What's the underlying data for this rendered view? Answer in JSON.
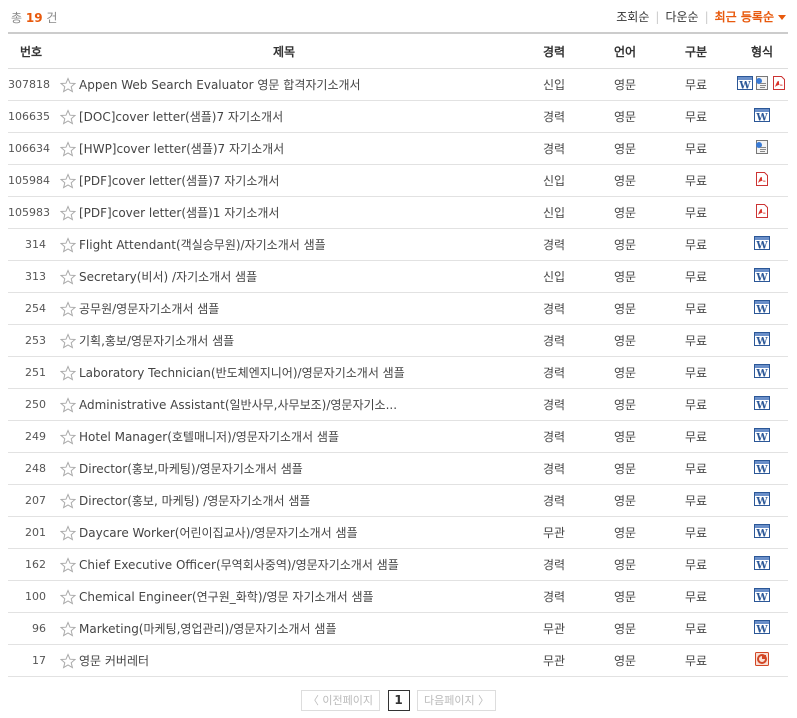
{
  "summary": {
    "prefix": "총",
    "count": "19",
    "suffix": "건"
  },
  "sort": {
    "views": "조회순",
    "downloads": "다운순",
    "recent": "최근 등록순"
  },
  "columns": {
    "no": "번호",
    "title": "제목",
    "career": "경력",
    "lang": "언어",
    "type": "구분",
    "format": "형식"
  },
  "rows": [
    {
      "no": "307818",
      "title": "Appen Web Search Evaluator 영문 합격자기소개서",
      "career": "신입",
      "lang": "영문",
      "type": "무료",
      "formats": [
        "doc",
        "hwp",
        "pdf"
      ]
    },
    {
      "no": "106635",
      "title": "[DOC]cover letter(샘플)7 자기소개서",
      "career": "경력",
      "lang": "영문",
      "type": "무료",
      "formats": [
        "doc"
      ]
    },
    {
      "no": "106634",
      "title": "[HWP]cover letter(샘플)7 자기소개서",
      "career": "경력",
      "lang": "영문",
      "type": "무료",
      "formats": [
        "hwp"
      ]
    },
    {
      "no": "105984",
      "title": "[PDF]cover letter(샘플)7 자기소개서",
      "career": "신입",
      "lang": "영문",
      "type": "무료",
      "formats": [
        "pdf"
      ]
    },
    {
      "no": "105983",
      "title": "[PDF]cover letter(샘플)1 자기소개서",
      "career": "신입",
      "lang": "영문",
      "type": "무료",
      "formats": [
        "pdf"
      ]
    },
    {
      "no": "314",
      "title": "Flight Attendant(객실승무원)/자기소개서 샘플",
      "career": "경력",
      "lang": "영문",
      "type": "무료",
      "formats": [
        "doc"
      ]
    },
    {
      "no": "313",
      "title": "Secretary(비서) /자기소개서 샘플",
      "career": "신입",
      "lang": "영문",
      "type": "무료",
      "formats": [
        "doc"
      ]
    },
    {
      "no": "254",
      "title": "공무원/영문자기소개서 샘플",
      "career": "경력",
      "lang": "영문",
      "type": "무료",
      "formats": [
        "doc"
      ]
    },
    {
      "no": "253",
      "title": "기획,홍보/영문자기소개서 샘플",
      "career": "경력",
      "lang": "영문",
      "type": "무료",
      "formats": [
        "doc"
      ]
    },
    {
      "no": "251",
      "title": "Laboratory Technician(반도체엔지니어)/영문자기소개서 샘플",
      "career": "경력",
      "lang": "영문",
      "type": "무료",
      "formats": [
        "doc"
      ]
    },
    {
      "no": "250",
      "title": "Administrative Assistant(일반사무,사무보조)/영문자기소...",
      "career": "경력",
      "lang": "영문",
      "type": "무료",
      "formats": [
        "doc"
      ]
    },
    {
      "no": "249",
      "title": "Hotel Manager(호텔매니저)/영문자기소개서 샘플",
      "career": "경력",
      "lang": "영문",
      "type": "무료",
      "formats": [
        "doc"
      ]
    },
    {
      "no": "248",
      "title": "Director(홍보,마케팅)/영문자기소개서 샘플",
      "career": "경력",
      "lang": "영문",
      "type": "무료",
      "formats": [
        "doc"
      ]
    },
    {
      "no": "207",
      "title": "Director(홍보, 마케팅) /영문자기소개서 샘플",
      "career": "경력",
      "lang": "영문",
      "type": "무료",
      "formats": [
        "doc"
      ]
    },
    {
      "no": "201",
      "title": "Daycare Worker(어린이집교사)/영문자기소개서 샘플",
      "career": "무관",
      "lang": "영문",
      "type": "무료",
      "formats": [
        "doc"
      ]
    },
    {
      "no": "162",
      "title": "Chief Executive Officer(무역회사중역)/영문자기소개서 샘플",
      "career": "경력",
      "lang": "영문",
      "type": "무료",
      "formats": [
        "doc"
      ]
    },
    {
      "no": "100",
      "title": "Chemical Engineer(연구원_화학)/영문 자기소개서 샘플",
      "career": "경력",
      "lang": "영문",
      "type": "무료",
      "formats": [
        "doc"
      ]
    },
    {
      "no": "96",
      "title": "Marketing(마케팅,영업관리)/영문자기소개서 샘플",
      "career": "무관",
      "lang": "영문",
      "type": "무료",
      "formats": [
        "doc"
      ]
    },
    {
      "no": "17",
      "title": "영문 커버레터",
      "career": "무관",
      "lang": "영문",
      "type": "무료",
      "formats": [
        "ppt"
      ]
    }
  ],
  "pagination": {
    "prev": "〈 이전페이지",
    "current": "1",
    "next": "다음페이지 〉"
  },
  "colors": {
    "accent": "#e8590c",
    "doc": "#2b5797",
    "pdf": "#d9342b",
    "ppt": "#d24726"
  }
}
